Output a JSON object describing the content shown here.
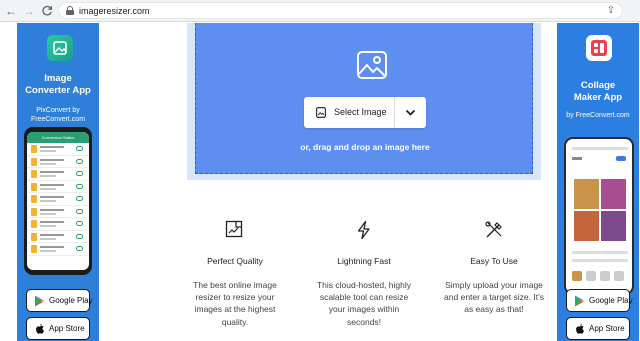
{
  "browser": {
    "url": "imageresizer.com",
    "back_icon": "arrow-left-icon",
    "forward_icon": "arrow-right-icon",
    "reload_icon": "reload-icon",
    "lock_icon": "lock-icon",
    "share_icon": "share-icon"
  },
  "left_ad": {
    "title_line1": "Image",
    "title_line2": "Converter App",
    "subtitle_line1": "PixConvert by",
    "subtitle_line2": "FreeConvert.com",
    "phone_header": "Conversion Status",
    "google_play_label": "Google Play",
    "app_store_label": "App Store"
  },
  "right_ad": {
    "title_line1": "Collage",
    "title_line2": "Maker App",
    "subtitle": "by FreeConvert.com",
    "google_play_label": "Google Play",
    "app_store_label": "App Store"
  },
  "upload": {
    "select_label": "Select Image",
    "drop_text": "or, drag and drop an image here",
    "accent_color": "#5e8ff0"
  },
  "features": [
    {
      "title": "Perfect Quality",
      "description_lines": [
        "The best online image",
        "resizer to resize your",
        "images at the highest",
        "quality."
      ],
      "icon": "quality-icon"
    },
    {
      "title": "Lightning Fast",
      "description_lines": [
        "This cloud-hosted, highly",
        "scalable tool can resize",
        "your images within",
        "seconds!"
      ],
      "icon": "lightning-icon"
    },
    {
      "title": "Easy To Use",
      "description_lines": [
        "Simply upload your image",
        "and enter a target size. It's",
        "as easy as that!"
      ],
      "icon": "tools-icon"
    }
  ]
}
